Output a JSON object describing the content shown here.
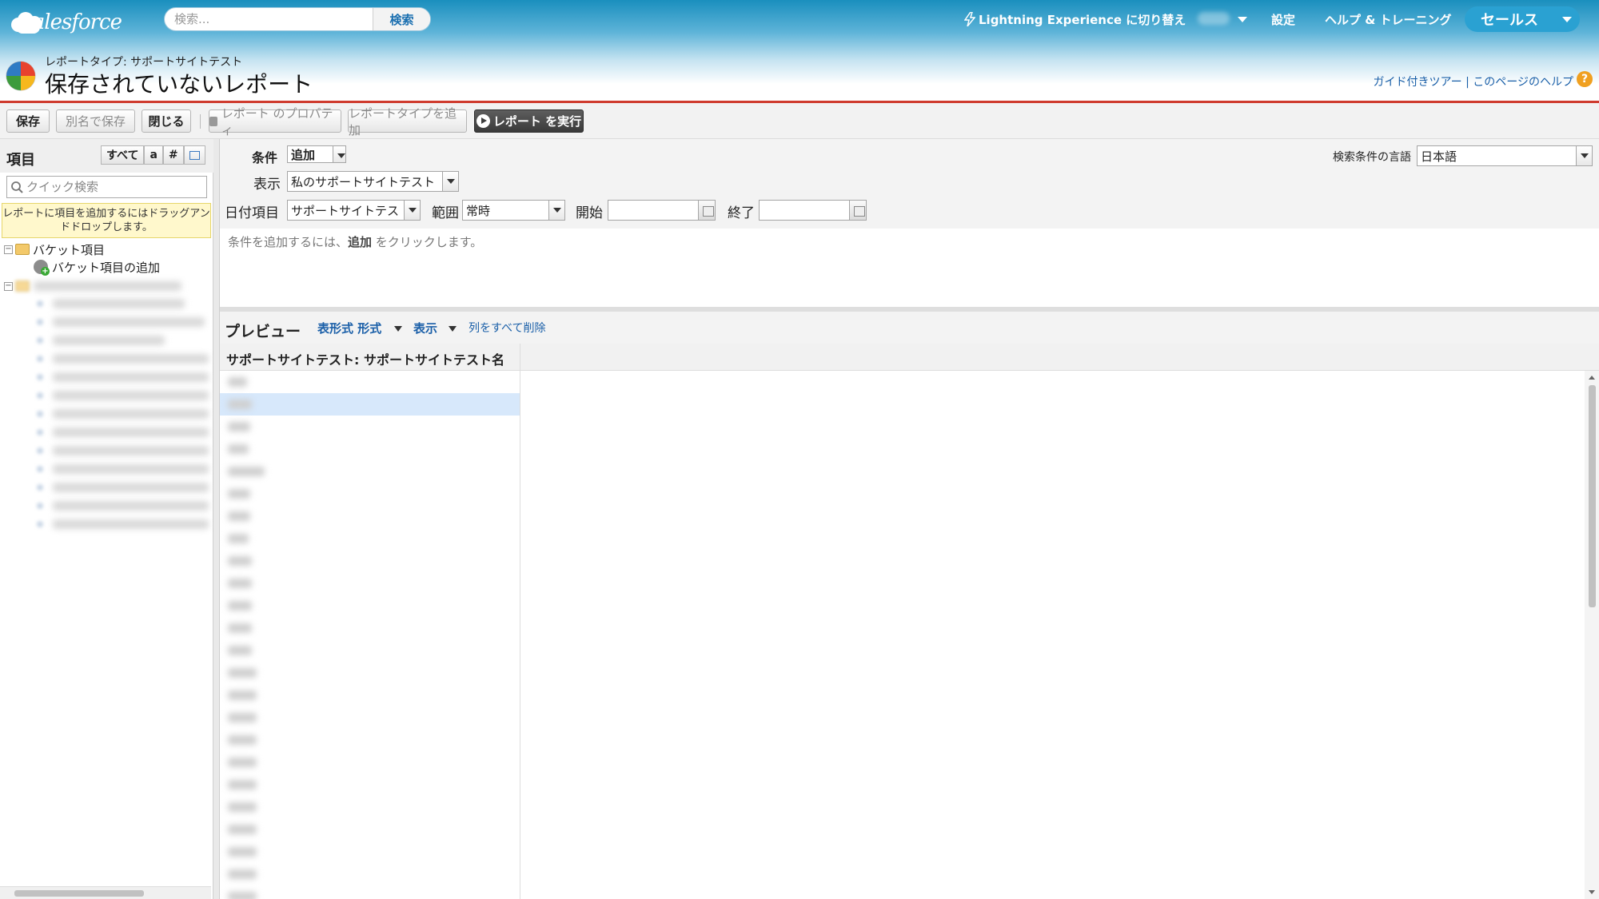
{
  "header": {
    "logo_text": "salesforce",
    "search_placeholder": "検索...",
    "search_button": "検索",
    "lightning_switch": "Lightning Experience に切り替え",
    "setup": "設定",
    "help_training": "ヘルプ & トレーニング",
    "app_menu": "セールス"
  },
  "page": {
    "report_type": "レポートタイプ: サポートサイトテスト",
    "title": "保存されていないレポート",
    "guided_tour": "ガイド付きツアー",
    "separator": "|",
    "page_help": "このページのヘルプ",
    "help_icon": "?"
  },
  "toolbar": {
    "save": "保存",
    "save_as": "別名で保存",
    "close": "閉じる",
    "report_properties": "レポート のプロパティ",
    "add_report_type": "レポートタイプを追加",
    "run_report": "レポート を実行"
  },
  "left_panel": {
    "title": "項目",
    "filter_all": "すべて",
    "filter_text": "a",
    "filter_number": "#",
    "quick_search_placeholder": "クイック検索",
    "hint": "レポートに項目を追加するにはドラッグアンドドロップします。",
    "tree": {
      "bucket_folder": "バケット項目",
      "add_bucket": "バケット項目の追加"
    }
  },
  "filters": {
    "conditions_label": "条件",
    "add_select": "追加",
    "show_label": "表示",
    "show_value": "私のサポートサイトテスト",
    "date_field_label": "日付項目",
    "date_field_value": "サポートサイトテス",
    "range_label": "範囲",
    "range_value": "常時",
    "start_label": "開始",
    "end_label": "終了",
    "language_label": "検索条件の言語",
    "language_value": "日本語",
    "empty_message_prefix": "条件を追加するには、",
    "empty_message_bold": "追加",
    "empty_message_suffix": " をクリックします。"
  },
  "preview": {
    "title": "プレビュー",
    "format": "表形式 形式",
    "show": "表示",
    "remove_all_columns": "列をすべて削除",
    "column_header": "サポートサイトテスト: サポートサイトテスト名"
  },
  "colors": {
    "header_top": "#1a8fbe",
    "header_rule": "#cf3b2e",
    "link": "#1a5fa8",
    "selected_row": "#d7e8fb"
  }
}
